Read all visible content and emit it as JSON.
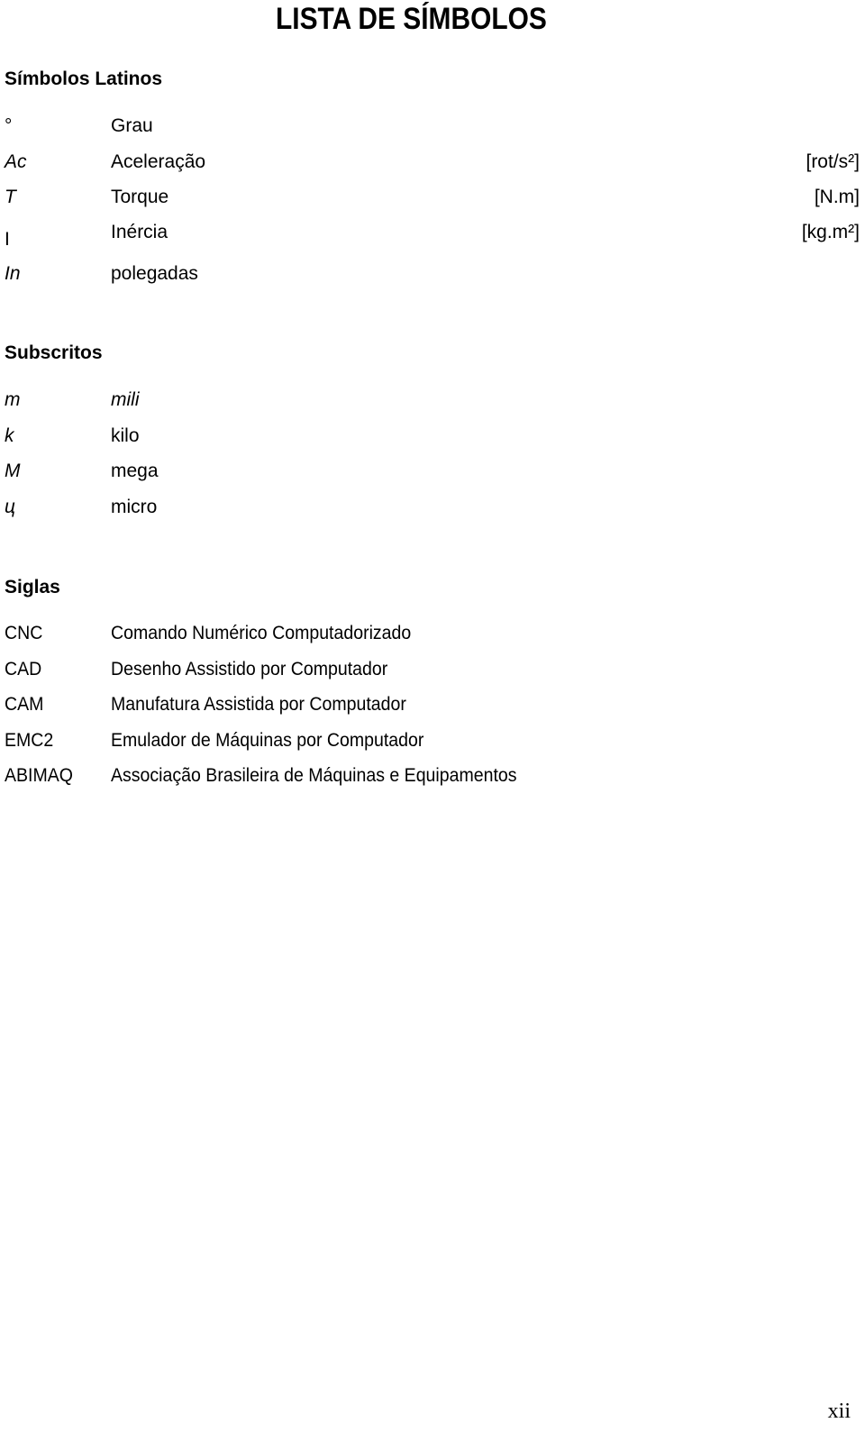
{
  "title": "LISTA DE SÍMBOLOS",
  "sections": {
    "latin": {
      "heading": "Símbolos Latinos",
      "rows": [
        {
          "symbol": "°",
          "description": "Grau",
          "unit": ""
        },
        {
          "symbol": "Ac",
          "description": "Aceleração",
          "unit": "[rot/s²]"
        },
        {
          "symbol": "T",
          "description": "Torque",
          "unit": "[N.m]"
        },
        {
          "symbol": "I",
          "description": "Inércia",
          "unit": "[kg.m²]"
        },
        {
          "symbol": "In",
          "description": "polegadas",
          "unit": ""
        }
      ]
    },
    "subscripts": {
      "heading": "Subscritos",
      "rows": [
        {
          "symbol": "m",
          "description": "mili"
        },
        {
          "symbol": "k",
          "description": "kilo"
        },
        {
          "symbol": "M",
          "description": "mega"
        },
        {
          "symbol": "ц",
          "description": "micro"
        }
      ]
    },
    "acronyms": {
      "heading": "Siglas",
      "rows": [
        {
          "symbol": "CNC",
          "description": "Comando Numérico Computadorizado"
        },
        {
          "symbol": "CAD",
          "description": "Desenho Assistido por Computador"
        },
        {
          "symbol": "CAM",
          "description": "Manufatura Assistida por Computador"
        },
        {
          "symbol": "EMC2",
          "description": "Emulador de Máquinas por Computador"
        },
        {
          "symbol": "ABIMAQ",
          "description": "Associação Brasileira de Máquinas e Equipamentos"
        }
      ]
    }
  },
  "page_number": "xii"
}
